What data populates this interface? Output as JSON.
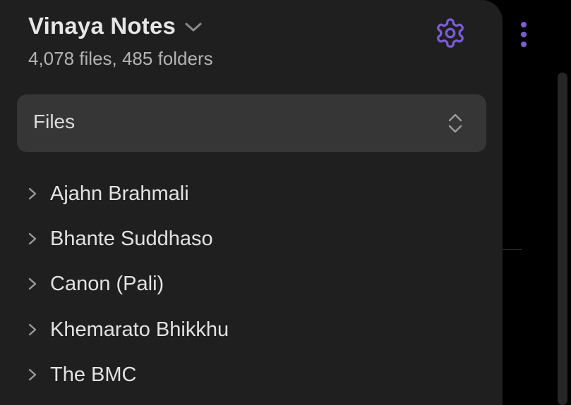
{
  "vault": {
    "name": "Vinaya Notes",
    "stats": "4,078 files, 485 folders"
  },
  "icons": {
    "vault_switcher": "chevron-down-icon",
    "settings": "gear-icon",
    "selector": "chevrons-up-down-icon",
    "folder_toggle": "chevron-right-icon",
    "more_options": "more-vertical-icon"
  },
  "selector": {
    "value": "Files"
  },
  "tree": {
    "items": [
      {
        "label": "Ajahn Brahmali"
      },
      {
        "label": "Bhante Suddhaso"
      },
      {
        "label": "Canon (Pali)"
      },
      {
        "label": "Khemarato Bhikkhu"
      },
      {
        "label": "The BMC"
      }
    ]
  },
  "colors": {
    "accent": "#7c5cd6",
    "sidebar_bg": "#1f1f1f",
    "selector_bg": "#363636",
    "page_bg": "#000000",
    "text_primary": "#e6e6e6",
    "text_muted": "#b3b3b3"
  }
}
